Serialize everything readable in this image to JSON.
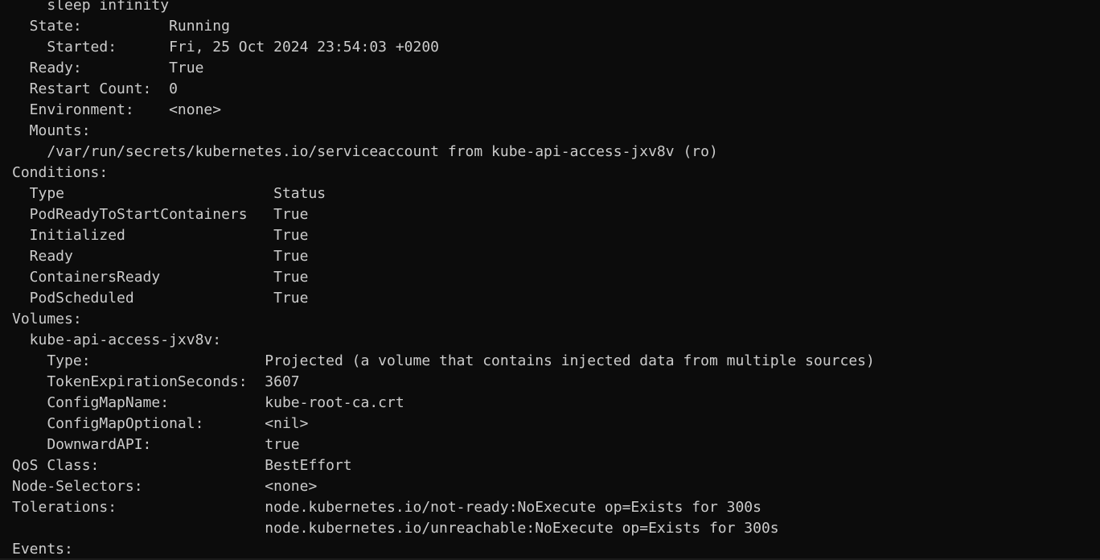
{
  "terminal": {
    "lines": [
      "    sleep infinity",
      "  State:          Running",
      "    Started:      Fri, 25 Oct 2024 23:54:03 +0200",
      "  Ready:          True",
      "  Restart Count:  0",
      "  Environment:    <none>",
      "  Mounts:",
      "    /var/run/secrets/kubernetes.io/serviceaccount from kube-api-access-jxv8v (ro)",
      "Conditions:",
      "  Type                        Status",
      "  PodReadyToStartContainers   True",
      "  Initialized                 True",
      "  Ready                       True",
      "  ContainersReady             True",
      "  PodScheduled                True",
      "Volumes:",
      "  kube-api-access-jxv8v:",
      "    Type:                    Projected (a volume that contains injected data from multiple sources)",
      "    TokenExpirationSeconds:  3607",
      "    ConfigMapName:           kube-root-ca.crt",
      "    ConfigMapOptional:       <nil>",
      "    DownwardAPI:             true",
      "QoS Class:                   BestEffort",
      "Node-Selectors:              <none>",
      "Tolerations:                 node.kubernetes.io/not-ready:NoExecute op=Exists for 300s",
      "                             node.kubernetes.io/unreachable:NoExecute op=Exists for 300s",
      "Events:"
    ]
  }
}
